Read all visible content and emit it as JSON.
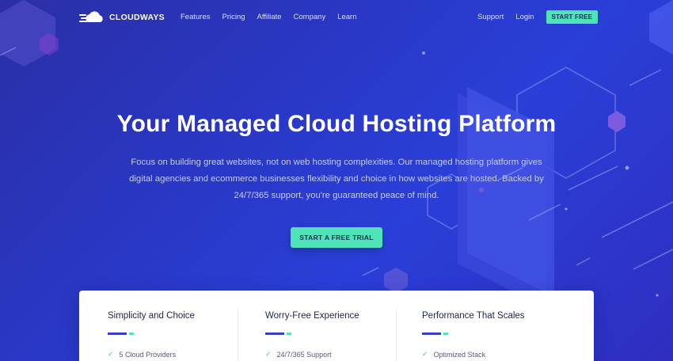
{
  "brand": {
    "name": "CLOUDWAYS"
  },
  "nav": {
    "links": [
      "Features",
      "Pricing",
      "Affiliate",
      "Company",
      "Learn"
    ],
    "support": "Support",
    "login": "Login",
    "start_free": "START FREE"
  },
  "hero": {
    "title": "Your Managed Cloud Hosting Platform",
    "subtitle": "Focus on building great websites, not on web hosting complexities. Our managed hosting platform gives digital agencies and ecommerce businesses flexibility and choice in how websites are hosted. Backed by 24/7/365 support, you're guaranteed peace of mind.",
    "cta": "START A FREE TRIAL"
  },
  "features": [
    {
      "title": "Simplicity and Choice",
      "item": "5 Cloud Providers"
    },
    {
      "title": "Worry-Free Experience",
      "item": "24/7/365 Support"
    },
    {
      "title": "Performance That Scales",
      "item": "Optimized Stack"
    }
  ],
  "colors": {
    "accent_green": "#4fe3b8",
    "hero_blue": "#2a3fd8",
    "bar_blue": "#3b3fbf"
  },
  "icons": {
    "logo": "cloud-logo-icon",
    "check": "check-icon"
  }
}
